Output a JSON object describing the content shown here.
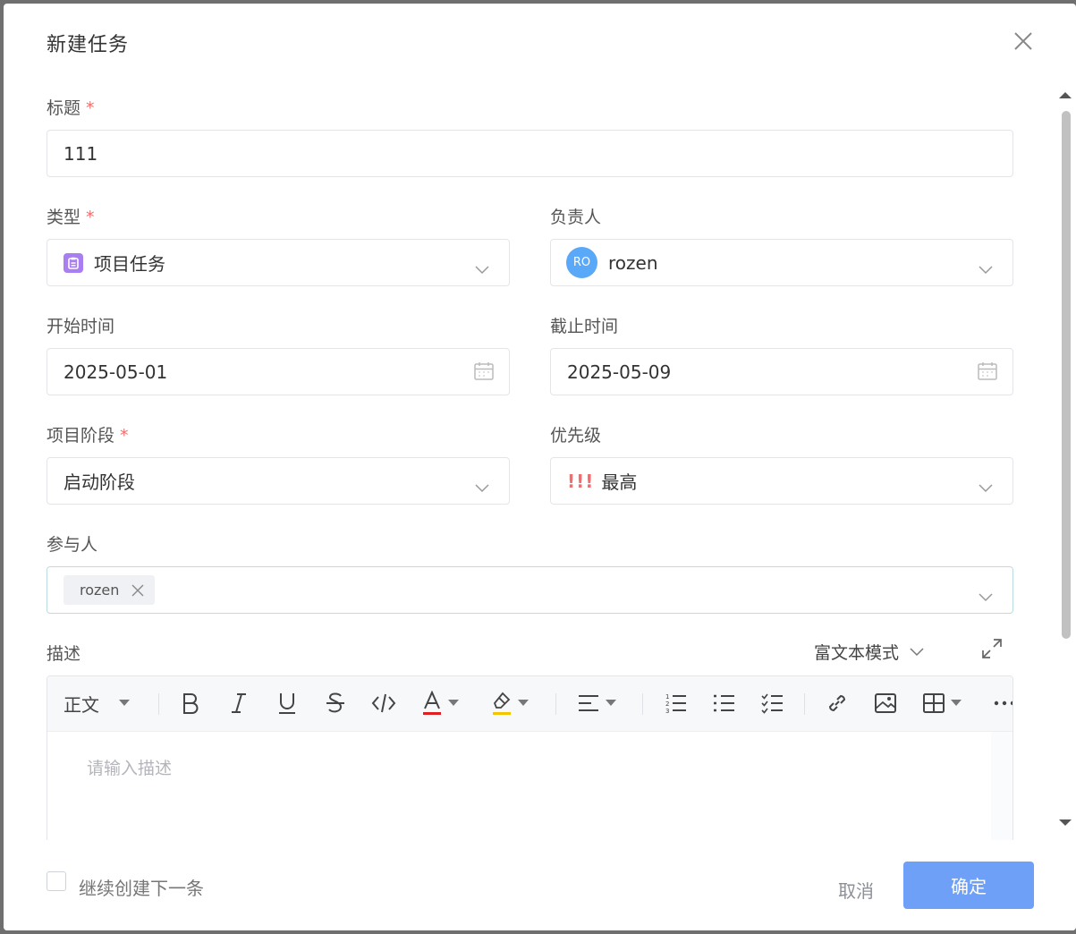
{
  "dialog": {
    "title": "新建任务"
  },
  "form": {
    "title_label": "标题",
    "required_mark": "*",
    "title_value": "111",
    "type_label": "类型",
    "type_value": "项目任务",
    "assignee_label": "负责人",
    "assignee_avatar": "RO",
    "assignee_value": "rozen",
    "start_label": "开始时间",
    "start_value": "2025-05-01",
    "end_label": "截止时间",
    "end_value": "2025-05-09",
    "stage_label": "项目阶段",
    "stage_value": "启动阶段",
    "priority_label": "优先级",
    "priority_mark": "!!!",
    "priority_value": "最高",
    "participants_label": "参与人",
    "participants": [
      "rozen"
    ],
    "description_label": "描述",
    "mode_value": "富文本模式"
  },
  "editor": {
    "paragraph_style": "正文",
    "placeholder": "请输入描述"
  },
  "footer": {
    "continue_label": "继续创建下一条",
    "cancel_label": "取消",
    "ok_label": "确定"
  },
  "colors": {
    "accent": "#6ea0f8",
    "required": "#f56c6c",
    "type_icon": "#a97ef0",
    "avatar": "#5aa8f8"
  }
}
